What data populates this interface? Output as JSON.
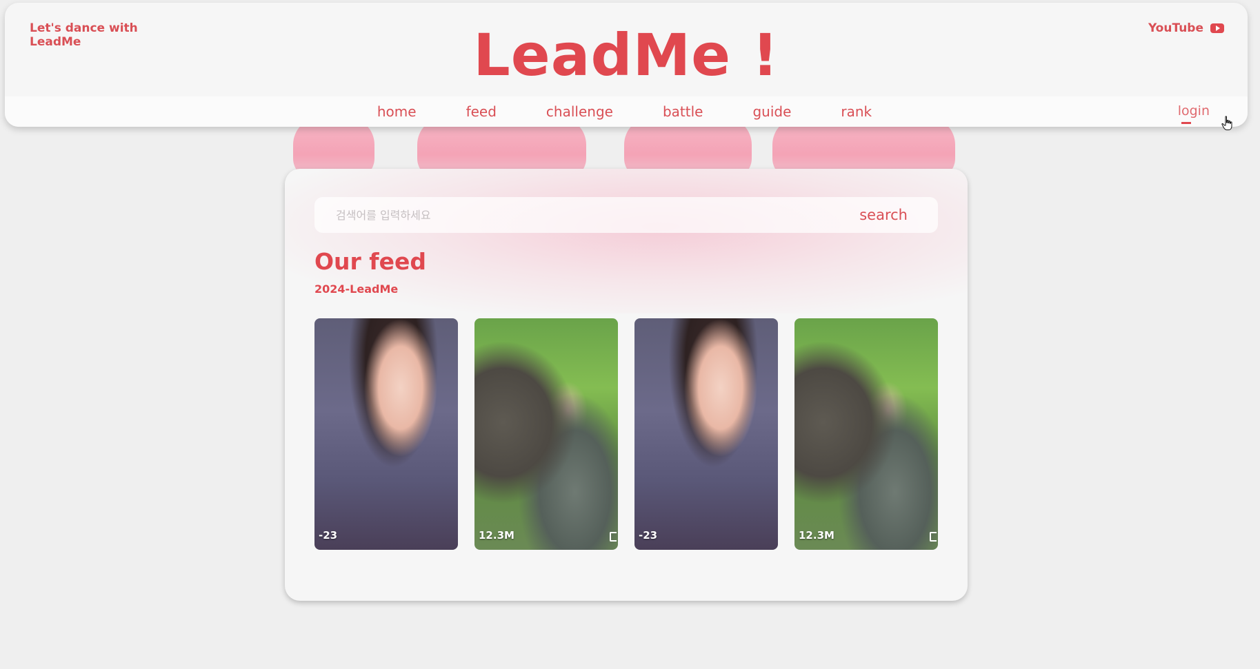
{
  "header": {
    "tagline": "Let's dance with LeadMe",
    "brand": "LeadMe !",
    "youtube_label": "YouTube",
    "nav": [
      {
        "label": "home"
      },
      {
        "label": "feed"
      },
      {
        "label": "challenge"
      },
      {
        "label": "battle"
      },
      {
        "label": "guide"
      },
      {
        "label": "rank"
      }
    ],
    "login_label": "login"
  },
  "search": {
    "placeholder": "검색어를 입력하세요",
    "value": "",
    "button_label": "search"
  },
  "feed": {
    "title": "Our feed",
    "subtitle": "2024-LeadMe",
    "items": [
      {
        "count": "-23",
        "style": "type-a"
      },
      {
        "count": "12.3M",
        "style": "type-b"
      },
      {
        "count": "-23",
        "style": "type-a"
      },
      {
        "count": "12.3M",
        "style": "type-b"
      }
    ]
  },
  "colors": {
    "accent": "#e0484f",
    "background": "#efefef",
    "card": "#f6f6f6"
  },
  "icons": {
    "youtube": "youtube-icon",
    "cursor": "hand-pointer-icon",
    "mute": "speaker-icon"
  }
}
